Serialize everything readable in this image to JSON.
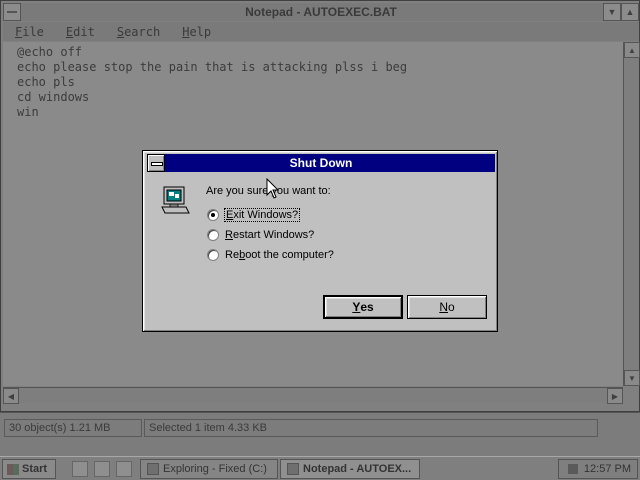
{
  "notepad": {
    "title": "Notepad - AUTOEXEC.BAT",
    "menu": [
      {
        "accel": "F",
        "rest": "ile"
      },
      {
        "accel": "E",
        "rest": "dit"
      },
      {
        "accel": "S",
        "rest": "earch"
      },
      {
        "accel": "H",
        "rest": "elp"
      }
    ],
    "content": "@echo off\necho please stop the pain that is attacking plss i beg\necho pls\ncd windows\nwin"
  },
  "explorer_status": {
    "left": "30 object(s)   1.21 MB",
    "right": "Selected 1 item   4.33 KB"
  },
  "taskbar": {
    "start_label": "Start",
    "tasks": [
      {
        "label": "Exploring - Fixed (C:)"
      },
      {
        "label": "Notepad - AUTOEX..."
      }
    ],
    "clock": "12:57 PM"
  },
  "dialog": {
    "title": "Shut Down",
    "prompt": "Are you sure you want to:",
    "options": [
      {
        "accel": "E",
        "rest": "xit Windows?",
        "checked": true
      },
      {
        "accel": "R",
        "rest": "estart Windows?",
        "checked": false
      },
      {
        "pre": "Re",
        "accel": "b",
        "rest": "oot the computer?",
        "checked": false
      }
    ],
    "yes": {
      "accel": "Y",
      "rest": "es"
    },
    "no": {
      "accel": "N",
      "rest": "o"
    }
  }
}
